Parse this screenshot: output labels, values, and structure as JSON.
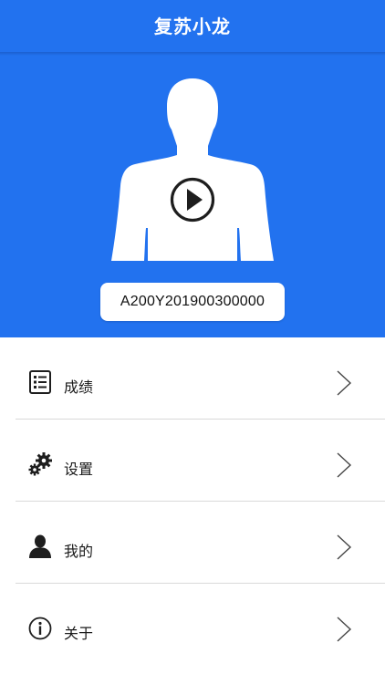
{
  "app": {
    "title": "复苏小龙"
  },
  "hero": {
    "serial": "A200Y201900300000"
  },
  "menu": {
    "items": [
      {
        "label": "成绩",
        "icon": "list-icon"
      },
      {
        "label": "设置",
        "icon": "gears-icon"
      },
      {
        "label": "我的",
        "icon": "user-icon"
      },
      {
        "label": "关于",
        "icon": "info-icon"
      }
    ]
  },
  "colors": {
    "primary": "#2272ef",
    "text": "#1a1a1a",
    "divider": "#d9d9d9"
  }
}
